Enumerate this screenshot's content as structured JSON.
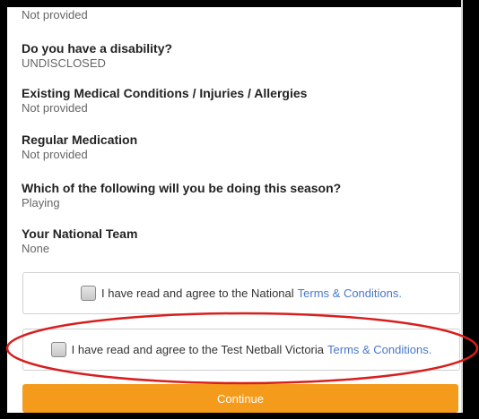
{
  "top_cut_value": "Not provided",
  "fields": [
    {
      "question": "Do you have a disability?",
      "answer": "UNDISCLOSED"
    },
    {
      "question": "Existing Medical Conditions / Injuries / Allergies",
      "answer": "Not provided"
    },
    {
      "question": "Regular Medication",
      "answer": "Not provided"
    },
    {
      "question": "Which of the following will you be doing this season?",
      "answer": "Playing"
    },
    {
      "question": "Your National Team",
      "answer": "None"
    }
  ],
  "terms": [
    {
      "text": "I have read and agree to the National",
      "link": "Terms & Conditions."
    },
    {
      "text": "I have read and agree to the Test Netball Victoria",
      "link": "Terms & Conditions."
    }
  ],
  "continue_label": "Continue",
  "colors": {
    "accent": "#f59b1c",
    "link": "#4a78c8",
    "annotation": "#d81e1e"
  }
}
